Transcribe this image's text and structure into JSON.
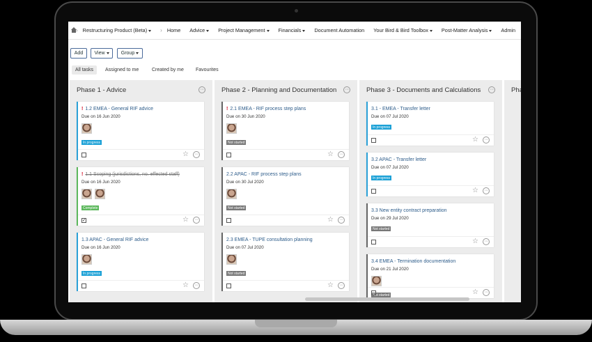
{
  "nav": {
    "breadcrumb": "Restructuring Product (Beta)",
    "items": [
      {
        "label": "Home",
        "caret": false
      },
      {
        "label": "Advice",
        "caret": true
      },
      {
        "label": "Project Management",
        "caret": true
      },
      {
        "label": "Financials",
        "caret": true
      },
      {
        "label": "Document Automation",
        "caret": false
      },
      {
        "label": "Your Bird & Bird Toolbox",
        "caret": true
      },
      {
        "label": "Post-Matter Analysis",
        "caret": true
      },
      {
        "label": "Admin",
        "caret": false
      }
    ]
  },
  "toolbar": {
    "add": "Add",
    "view": "View",
    "group": "Group"
  },
  "tabs": [
    "All tasks",
    "Assigned to me",
    "Created by me",
    "Favourites"
  ],
  "columns": [
    {
      "title": "Phase 1 - Advice",
      "cards": [
        {
          "title": "1.2 EMEA - General RIF advice",
          "due": "Due on 16 Jun 2020",
          "status": "In progress",
          "urgent": true,
          "done": false,
          "checked": false,
          "avatars": 1
        },
        {
          "title": "1.1 Scoping (jurisdictions, no. effected staff)",
          "due": "Due on 16 Jun 2020",
          "status": "Complete",
          "urgent": true,
          "done": true,
          "checked": true,
          "avatars": 2
        },
        {
          "title": "1.3 APAC - General RIF advice",
          "due": "Due on 16 Jun 2020",
          "status": "In progress",
          "urgent": false,
          "done": false,
          "checked": false,
          "avatars": 1
        }
      ]
    },
    {
      "title": "Phase 2 - Planning and Documentation",
      "cards": [
        {
          "title": "2.1 EMEA - RIF process step plans",
          "due": "Due on 30 Jun 2020",
          "status": "Not started",
          "urgent": true,
          "done": false,
          "checked": false,
          "avatars": 1
        },
        {
          "title": "2.2 APAC - RIF process step plans",
          "due": "Due on 30 Jul 2020",
          "status": "Not started",
          "urgent": false,
          "done": false,
          "checked": false,
          "avatars": 1
        },
        {
          "title": "2.3 EMEA - TUPE consultation planning",
          "due": "Due on 07 Jul 2020",
          "status": "Not started",
          "urgent": false,
          "done": false,
          "checked": false,
          "avatars": 1
        }
      ]
    },
    {
      "title": "Phase 3 - Documents and Calculations",
      "cards": [
        {
          "title": "3.1 - EMEA - Transfer letter",
          "due": "Due on 07 Jul 2020",
          "status": "In progress",
          "urgent": false,
          "done": false,
          "checked": false,
          "avatars": 0
        },
        {
          "title": "3.2 APAC - Transfer letter",
          "due": "Due on 07 Jul 2020",
          "status": "In progress",
          "urgent": false,
          "done": false,
          "checked": false,
          "avatars": 0
        },
        {
          "title": "3.3 New entity contract preparation",
          "due": "Due on 29 Jul 2020",
          "status": "Not started",
          "urgent": false,
          "done": false,
          "checked": false,
          "avatars": 0
        },
        {
          "title": "3.4 EMEA - Termination documentation",
          "due": "Due on 21 Jul 2020",
          "status": "Not started",
          "urgent": false,
          "done": false,
          "checked": false,
          "avatars": 1
        }
      ]
    },
    {
      "title": "Pha",
      "cards": []
    }
  ],
  "colors": {
    "in_progress": "#1aa0d6",
    "not_started": "#777777",
    "complete": "#5cb85c",
    "urgent": "#d0021b"
  }
}
